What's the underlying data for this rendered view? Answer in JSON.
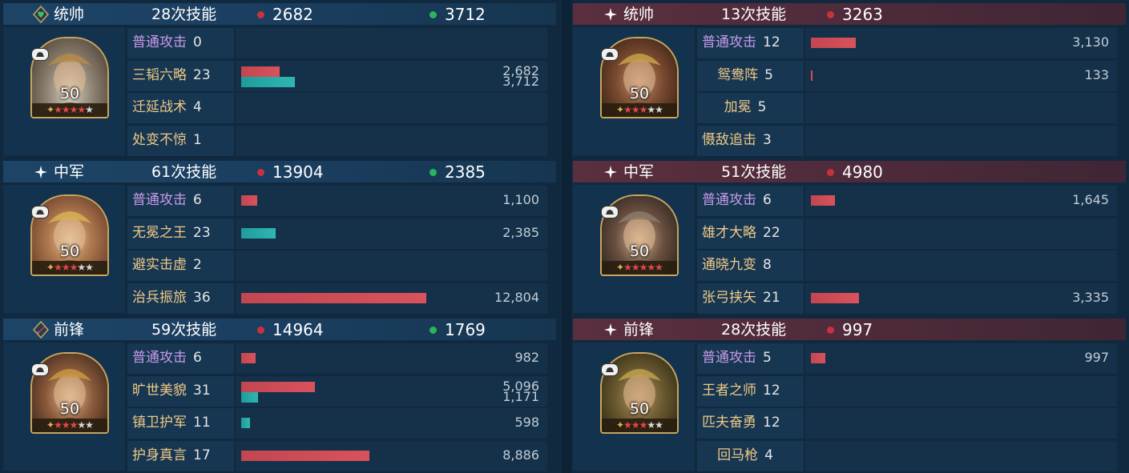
{
  "left": {
    "sections": [
      {
        "role": "统帅",
        "role_icon": "shield-heart-icon",
        "casts": "28次技能",
        "damage": "2682",
        "heal": "3712",
        "level": "50",
        "stars": {
          "red": 4,
          "gray": 1
        },
        "skills": [
          {
            "name": "普通攻击",
            "count": "0",
            "type": "basic",
            "damage": null,
            "heal": null,
            "damage_label": "",
            "heal_label": ""
          },
          {
            "name": "三韬六略",
            "count": "23",
            "type": "normal",
            "damage": 2682,
            "heal": 3712,
            "damage_label": "2,682",
            "heal_label": "3,712"
          },
          {
            "name": "迁延战术",
            "count": "4",
            "type": "normal",
            "damage": null,
            "heal": null,
            "damage_label": "",
            "heal_label": ""
          },
          {
            "name": "处变不惊",
            "count": "1",
            "type": "normal",
            "damage": null,
            "heal": null,
            "damage_label": "",
            "heal_label": ""
          }
        ]
      },
      {
        "role": "中军",
        "role_icon": "sparkle-icon",
        "casts": "61次技能",
        "damage": "13904",
        "heal": "2385",
        "level": "50",
        "stars": {
          "red": 3,
          "gray": 2
        },
        "skills": [
          {
            "name": "普通攻击",
            "count": "6",
            "type": "basic",
            "damage": 1100,
            "heal": null,
            "damage_label": "1,100",
            "heal_label": ""
          },
          {
            "name": "无冕之王",
            "count": "23",
            "type": "normal",
            "damage": null,
            "heal": 2385,
            "damage_label": "",
            "heal_label": "2,385"
          },
          {
            "name": "避实击虚",
            "count": "2",
            "type": "normal",
            "damage": null,
            "heal": null,
            "damage_label": "",
            "heal_label": ""
          },
          {
            "name": "治兵振旅",
            "count": "36",
            "type": "normal",
            "damage": 12804,
            "heal": null,
            "damage_label": "12,804",
            "heal_label": ""
          }
        ]
      },
      {
        "role": "前锋",
        "role_icon": "sword-icon",
        "casts": "59次技能",
        "damage": "14964",
        "heal": "1769",
        "level": "50",
        "stars": {
          "red": 3,
          "gray": 2
        },
        "skills": [
          {
            "name": "普通攻击",
            "count": "6",
            "type": "basic",
            "damage": 982,
            "heal": null,
            "damage_label": "982",
            "heal_label": ""
          },
          {
            "name": "旷世美貌",
            "count": "31",
            "type": "normal",
            "damage": 5096,
            "heal": 1171,
            "damage_label": "5,096",
            "heal_label": "1,171"
          },
          {
            "name": "镇卫护军",
            "count": "11",
            "type": "normal",
            "damage": null,
            "heal": 598,
            "damage_label": "",
            "heal_label": "598"
          },
          {
            "name": "护身真言",
            "count": "17",
            "type": "normal",
            "damage": 8886,
            "heal": null,
            "damage_label": "8,886",
            "heal_label": ""
          }
        ]
      }
    ]
  },
  "right": {
    "sections": [
      {
        "role": "统帅",
        "role_icon": "sparkle-icon",
        "casts": "13次技能",
        "damage": "3263",
        "heal": "",
        "level": "50",
        "stars": {
          "red": 3,
          "gray": 2
        },
        "skills": [
          {
            "name": "普通攻击",
            "count": "12",
            "type": "basic",
            "damage": 3130,
            "heal": null,
            "damage_label": "3,130",
            "heal_label": ""
          },
          {
            "name": "鸳鸯阵",
            "count": "5",
            "type": "normal",
            "damage": 133,
            "heal": null,
            "damage_label": "133",
            "heal_label": ""
          },
          {
            "name": "加冕",
            "count": "5",
            "type": "normal",
            "damage": null,
            "heal": null,
            "damage_label": "",
            "heal_label": ""
          },
          {
            "name": "慑敌追击",
            "count": "3",
            "type": "normal",
            "damage": null,
            "heal": null,
            "damage_label": "",
            "heal_label": ""
          }
        ]
      },
      {
        "role": "中军",
        "role_icon": "sparkle-icon",
        "casts": "51次技能",
        "damage": "4980",
        "heal": "",
        "level": "50",
        "stars": {
          "red": 5,
          "gray": 0
        },
        "skills": [
          {
            "name": "普通攻击",
            "count": "6",
            "type": "basic",
            "damage": 1645,
            "heal": null,
            "damage_label": "1,645",
            "heal_label": ""
          },
          {
            "name": "雄才大略",
            "count": "22",
            "type": "normal",
            "damage": null,
            "heal": null,
            "damage_label": "",
            "heal_label": ""
          },
          {
            "name": "通晓九变",
            "count": "8",
            "type": "normal",
            "damage": null,
            "heal": null,
            "damage_label": "",
            "heal_label": ""
          },
          {
            "name": "张弓挟矢",
            "count": "21",
            "type": "normal",
            "damage": 3335,
            "heal": null,
            "damage_label": "3,335",
            "heal_label": ""
          }
        ]
      },
      {
        "role": "前锋",
        "role_icon": "sparkle-icon",
        "casts": "28次技能",
        "damage": "997",
        "heal": "",
        "level": "50",
        "stars": {
          "red": 3,
          "gray": 2
        },
        "skills": [
          {
            "name": "普通攻击",
            "count": "5",
            "type": "basic",
            "damage": 997,
            "heal": null,
            "damage_label": "997",
            "heal_label": ""
          },
          {
            "name": "王者之师",
            "count": "12",
            "type": "normal",
            "damage": null,
            "heal": null,
            "damage_label": "",
            "heal_label": ""
          },
          {
            "name": "匹夫奋勇",
            "count": "12",
            "type": "normal",
            "damage": null,
            "heal": null,
            "damage_label": "",
            "heal_label": ""
          },
          {
            "name": "回马枪",
            "count": "4",
            "type": "normal",
            "damage": null,
            "heal": null,
            "damage_label": "",
            "heal_label": ""
          }
        ]
      }
    ]
  },
  "colors": {
    "damage": "#c8323e",
    "heal": "#2bb55a",
    "basic_skill": "#c89be8",
    "skill": "#f0c987"
  }
}
